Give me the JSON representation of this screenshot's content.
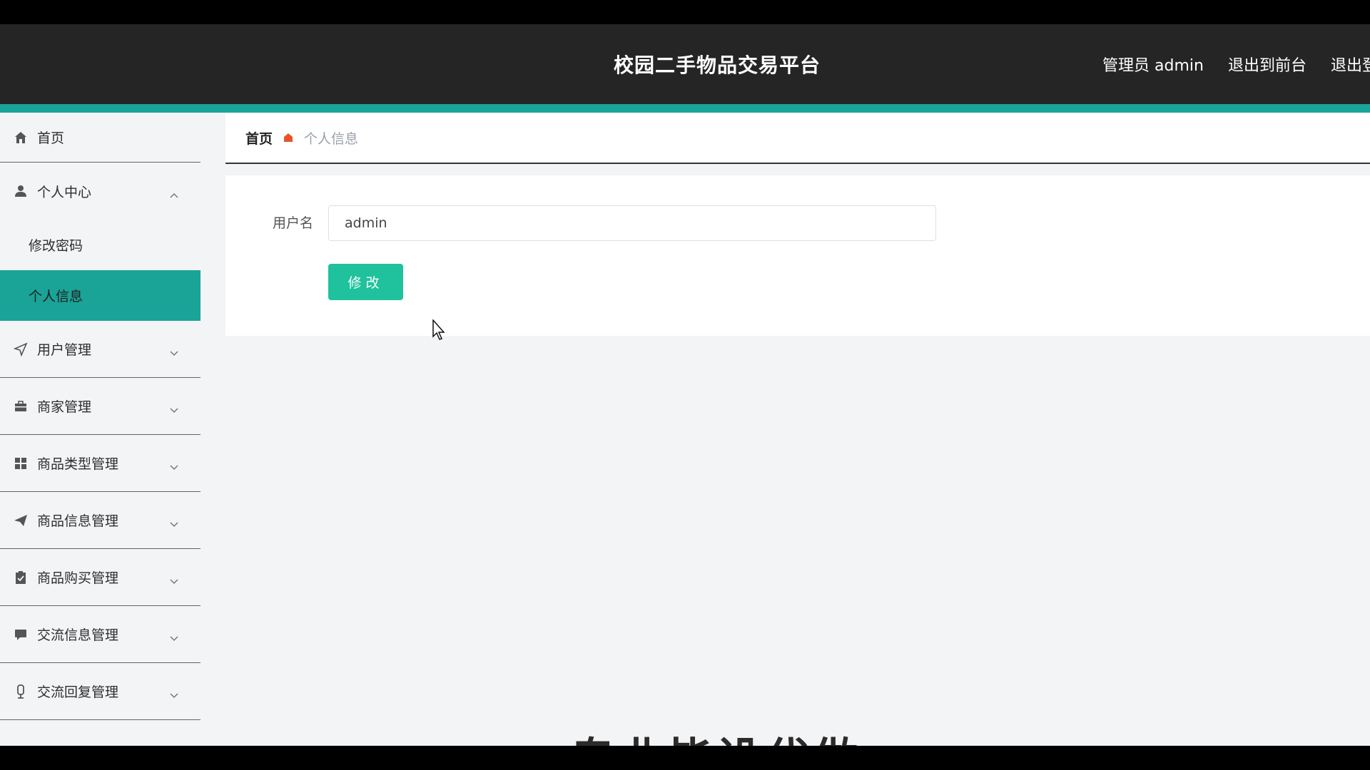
{
  "header": {
    "app_title": "校园二手物品交易平台",
    "admin_label": "管理员 admin",
    "exit_front_label": "退出到前台",
    "logout_label": "退出登"
  },
  "sidebar": {
    "items": [
      {
        "label": "首页",
        "icon": "home-icon"
      },
      {
        "label": "个人中心",
        "icon": "user-icon",
        "expanded": true,
        "children": [
          {
            "label": "修改密码"
          },
          {
            "label": "个人信息",
            "active": true
          }
        ]
      },
      {
        "label": "用户管理",
        "icon": "send-icon"
      },
      {
        "label": "商家管理",
        "icon": "briefcase-icon"
      },
      {
        "label": "商品类型管理",
        "icon": "grid-icon"
      },
      {
        "label": "商品信息管理",
        "icon": "paper-plane-icon"
      },
      {
        "label": "商品购买管理",
        "icon": "clipboard-icon"
      },
      {
        "label": "交流信息管理",
        "icon": "message-icon"
      },
      {
        "label": "交流回复管理",
        "icon": "microphone-icon"
      }
    ]
  },
  "breadcrumb": {
    "home": "首页",
    "current": "个人信息"
  },
  "form": {
    "username_label": "用户名",
    "username_value": "admin",
    "submit_label": "修改"
  },
  "overlay": {
    "watermark_text": "专业毕设代做"
  },
  "colors": {
    "topbar": "#252525",
    "accent": "#1aa397",
    "button": "#1fc29d",
    "breadcrumb_sep": "#e8542a"
  }
}
